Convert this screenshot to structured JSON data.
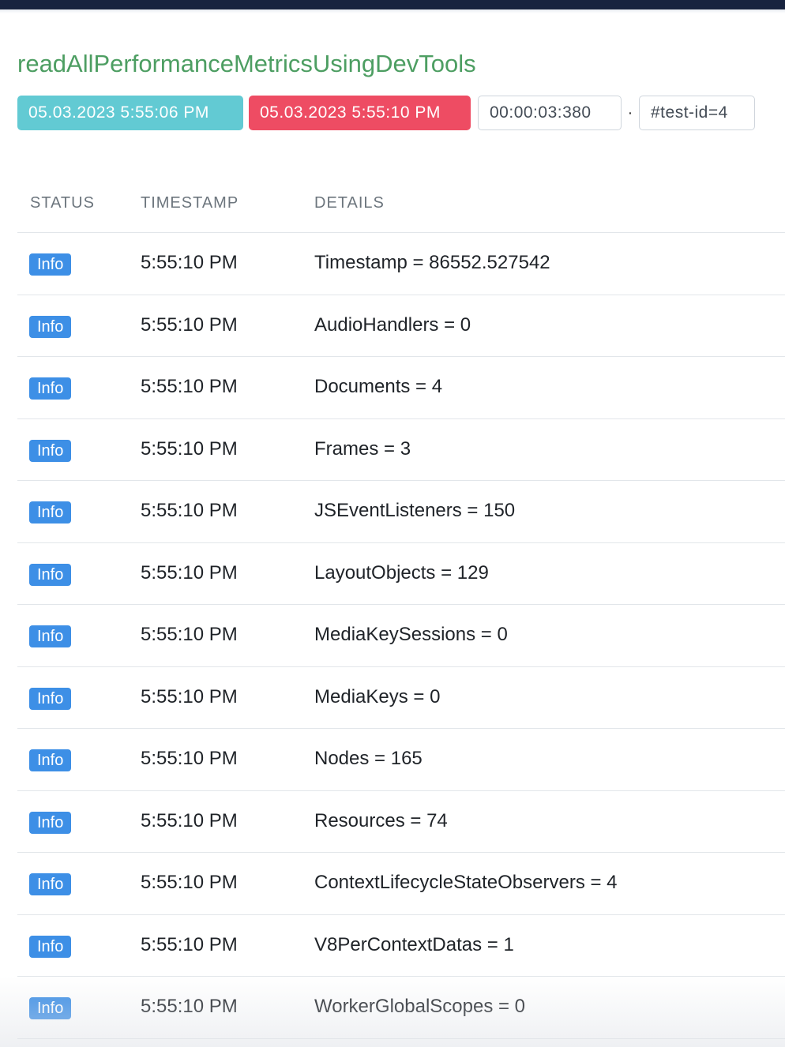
{
  "test": {
    "title": "readAllPerformanceMetricsUsingDevTools",
    "start_time": "05.03.2023 5:55:06 PM",
    "end_time": "05.03.2023 5:55:10 PM",
    "duration": "00:00:03:380",
    "separator": "·",
    "test_id": "#test-id=4"
  },
  "colors": {
    "title": "#4d9e62",
    "start_badge": "#62cad3",
    "end_badge": "#ee4c63",
    "info_badge": "#3d8fe6",
    "topbar": "#17233f"
  },
  "table": {
    "headers": {
      "status": "Status",
      "timestamp": "Timestamp",
      "details": "Details"
    },
    "rows": [
      {
        "status": "Info",
        "time": "5:55:10 PM",
        "details": "Timestamp = 86552.527542"
      },
      {
        "status": "Info",
        "time": "5:55:10 PM",
        "details": "AudioHandlers = 0"
      },
      {
        "status": "Info",
        "time": "5:55:10 PM",
        "details": "Documents = 4"
      },
      {
        "status": "Info",
        "time": "5:55:10 PM",
        "details": "Frames = 3"
      },
      {
        "status": "Info",
        "time": "5:55:10 PM",
        "details": "JSEventListeners = 150"
      },
      {
        "status": "Info",
        "time": "5:55:10 PM",
        "details": "LayoutObjects = 129"
      },
      {
        "status": "Info",
        "time": "5:55:10 PM",
        "details": "MediaKeySessions = 0"
      },
      {
        "status": "Info",
        "time": "5:55:10 PM",
        "details": "MediaKeys = 0"
      },
      {
        "status": "Info",
        "time": "5:55:10 PM",
        "details": "Nodes = 165"
      },
      {
        "status": "Info",
        "time": "5:55:10 PM",
        "details": "Resources = 74"
      },
      {
        "status": "Info",
        "time": "5:55:10 PM",
        "details": "ContextLifecycleStateObservers = 4"
      },
      {
        "status": "Info",
        "time": "5:55:10 PM",
        "details": "V8PerContextDatas = 1"
      },
      {
        "status": "Info",
        "time": "5:55:10 PM",
        "details": "WorkerGlobalScopes = 0"
      }
    ]
  }
}
